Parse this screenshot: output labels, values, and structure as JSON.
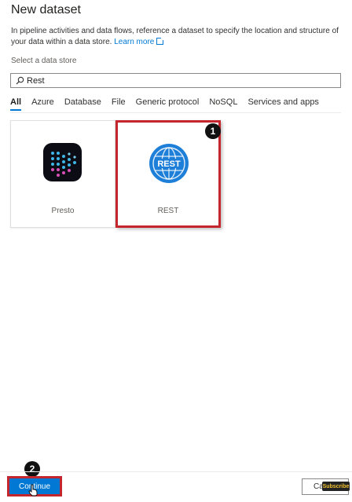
{
  "dialog": {
    "title": "New dataset",
    "description": "In pipeline activities and data flows, reference a dataset to specify the location and structure of your data within a data store.",
    "learn_more": "Learn more"
  },
  "store": {
    "label": "Select a data store",
    "search_value": "Rest"
  },
  "tabs": [
    {
      "label": "All",
      "active": true
    },
    {
      "label": "Azure"
    },
    {
      "label": "Database"
    },
    {
      "label": "File"
    },
    {
      "label": "Generic protocol"
    },
    {
      "label": "NoSQL"
    },
    {
      "label": "Services and apps"
    }
  ],
  "cards": [
    {
      "label": "Presto",
      "icon": "presto-logo"
    },
    {
      "label": "REST",
      "icon": "rest-globe-logo",
      "logo_text": "REST",
      "selected": true
    }
  ],
  "markers": {
    "one": "1",
    "two": "2"
  },
  "footer": {
    "continue_label": "Continue",
    "cancel_label": "Cancel",
    "overlay_badge": "Subscribe"
  },
  "colors": {
    "accent": "#0078d4",
    "highlight_border": "#c4262e",
    "rest_logo": "#1e7fd8",
    "presto_bg": "#0c0c14"
  }
}
